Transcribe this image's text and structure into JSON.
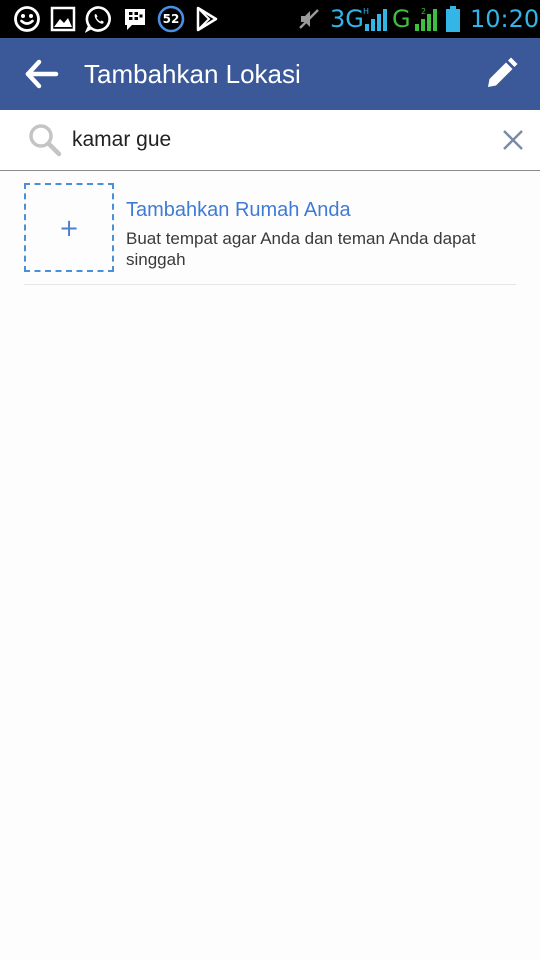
{
  "status_bar": {
    "notification_icons": [
      "smiley-icon",
      "image-icon",
      "whatsapp-icon",
      "bbm-icon",
      "notification-count-icon",
      "play-store-icon"
    ],
    "notification_count": "52",
    "network_3g": "3G",
    "network_g": "G",
    "time": "10:20",
    "network_color": "#33b5e5",
    "network_g_color": "#3fbf3f"
  },
  "appbar": {
    "title": "Tambahkan Lokasi",
    "background": "#3b5998"
  },
  "search": {
    "value": "kamar gue",
    "placeholder": ""
  },
  "results": [
    {
      "title": "Tambahkan Rumah Anda",
      "subtitle": "Buat tempat agar Anda dan teman Anda dapat singgah",
      "thumb_symbol": "+"
    }
  ]
}
